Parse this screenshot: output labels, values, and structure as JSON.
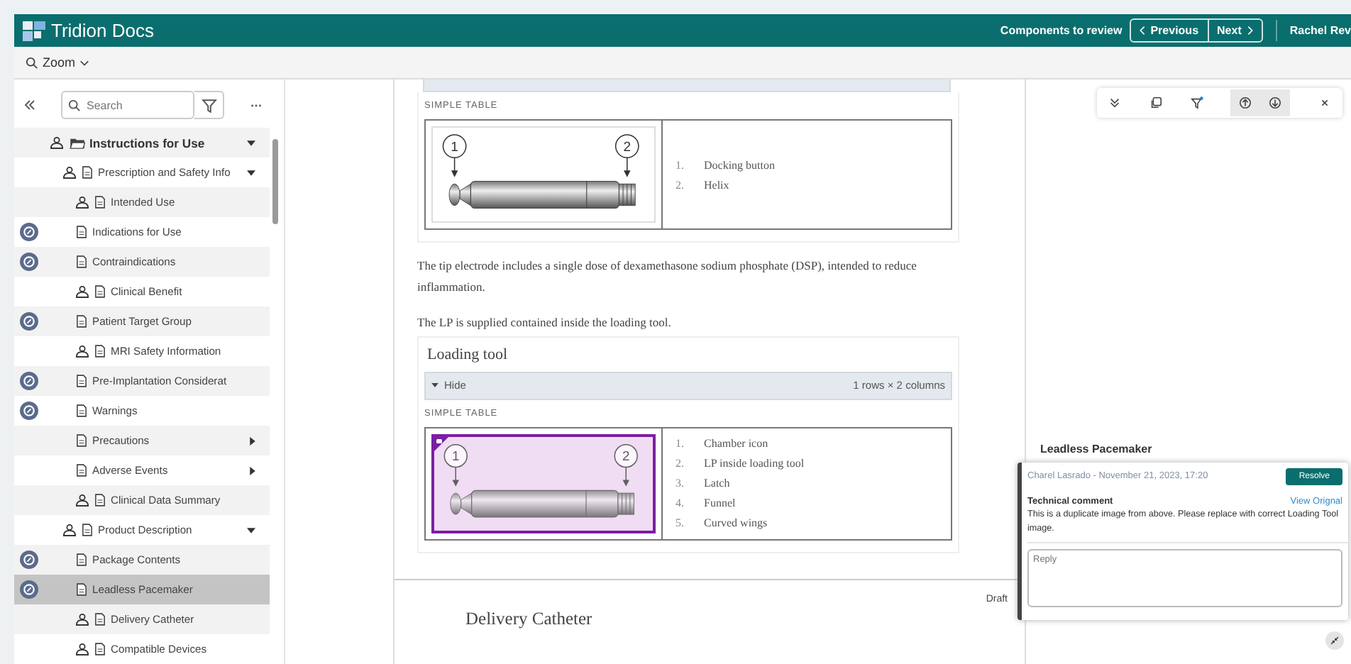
{
  "header": {
    "app_title": "Tridion Docs",
    "review_label": "Components to review",
    "previous": "Previous",
    "next": "Next",
    "user": "Rachel Rev"
  },
  "toolbar": {
    "zoom": "Zoom"
  },
  "sidebar": {
    "search": {
      "placeholder": "Search"
    },
    "tree": [
      {
        "label": "Instructions for Use",
        "kind": "folder",
        "locked": true,
        "comment": false,
        "expanded": true,
        "selected": false,
        "children": [
          {
            "label": "Prescription and Safety Info",
            "kind": "document",
            "locked": true,
            "comment": false,
            "expanded": true,
            "selected": false,
            "children": [
              {
                "label": "Intended Use",
                "kind": "document",
                "locked": true,
                "comment": false,
                "selected": false
              },
              {
                "label": "Indications for Use",
                "kind": "document",
                "locked": false,
                "comment": true,
                "selected": false
              },
              {
                "label": "Contraindications",
                "kind": "document",
                "locked": false,
                "comment": true,
                "selected": false
              },
              {
                "label": "Clinical Benefit",
                "kind": "document",
                "locked": true,
                "comment": false,
                "selected": false
              },
              {
                "label": "Patient Target Group",
                "kind": "document",
                "locked": false,
                "comment": true,
                "selected": false
              },
              {
                "label": "MRI Safety Information",
                "kind": "document",
                "locked": true,
                "comment": false,
                "selected": false
              },
              {
                "label": "Pre-Implantation Considerat",
                "kind": "document",
                "locked": false,
                "comment": true,
                "selected": false
              },
              {
                "label": "Warnings",
                "kind": "document",
                "locked": false,
                "comment": true,
                "selected": false
              },
              {
                "label": "Precautions",
                "kind": "document",
                "locked": false,
                "comment": false,
                "expanded": false,
                "selected": false
              },
              {
                "label": "Adverse Events",
                "kind": "document",
                "locked": false,
                "comment": false,
                "expanded": false,
                "selected": false
              },
              {
                "label": "Clinical Data Summary",
                "kind": "document",
                "locked": true,
                "comment": false,
                "selected": false
              }
            ]
          },
          {
            "label": "Product Description",
            "kind": "document",
            "locked": true,
            "comment": false,
            "expanded": true,
            "selected": false,
            "children": [
              {
                "label": "Package Contents",
                "kind": "document",
                "locked": false,
                "comment": true,
                "selected": false
              },
              {
                "label": "Leadless Pacemaker",
                "kind": "document",
                "locked": false,
                "comment": true,
                "selected": true
              },
              {
                "label": "Delivery Catheter",
                "kind": "document",
                "locked": true,
                "comment": false,
                "selected": false
              },
              {
                "label": "Compatible Devices",
                "kind": "document",
                "locked": true,
                "comment": false,
                "selected": false
              }
            ]
          }
        ]
      }
    ]
  },
  "document": {
    "blocks": [
      {
        "kind": "table",
        "caption": "SIMPLE TABLE",
        "commented": false,
        "callouts": [
          "1",
          "2"
        ],
        "items": [
          {
            "number": "1.",
            "text": "Docking button"
          },
          {
            "number": "2.",
            "text": "Helix"
          }
        ]
      },
      {
        "kind": "paragraph",
        "text": "The tip electrode includes a single dose of dexamethasone sodium phosphate (DSP), intended to reduce inflammation."
      },
      {
        "kind": "paragraph",
        "text": "The LP is supplied contained inside the loading tool."
      },
      {
        "kind": "section",
        "title": "Loading tool",
        "toggle": "Hide",
        "size": "1 rows × 2 columns",
        "table": {
          "caption": "SIMPLE TABLE",
          "commented": true,
          "callouts": [
            "1",
            "2"
          ],
          "items": [
            {
              "number": "1.",
              "text": "Chamber icon"
            },
            {
              "number": "2.",
              "text": "LP inside loading tool"
            },
            {
              "number": "3.",
              "text": "Latch"
            },
            {
              "number": "4.",
              "text": "Funnel"
            },
            {
              "number": "5.",
              "text": "Curved wings"
            }
          ]
        }
      }
    ],
    "status": "Draft",
    "next_heading": "Delivery Catheter"
  },
  "panel": {
    "topic": "Leadless Pacemaker",
    "comment": {
      "author": "Charel Lasrado - November 21, 2023, 17:20",
      "resolve": "Resolve",
      "type": "Technical comment",
      "link": "View Orignal",
      "text": "This is a duplicate image from above. Please replace with correct Loading Tool image.",
      "reply_placeholder": "Reply"
    }
  }
}
